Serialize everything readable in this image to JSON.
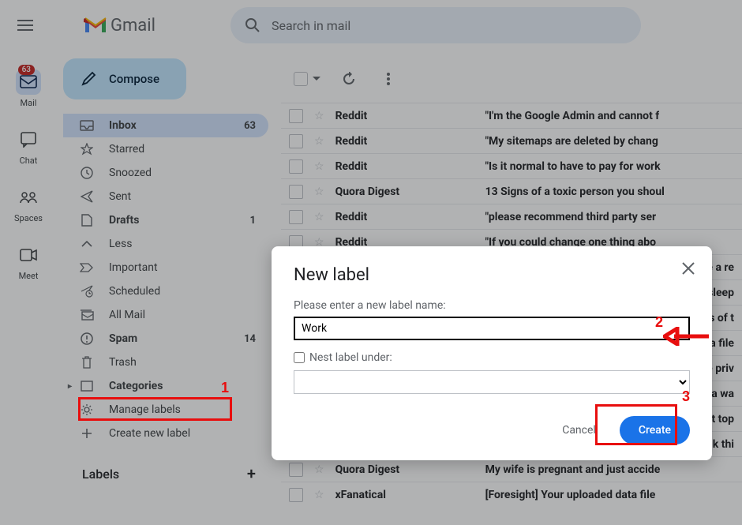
{
  "header": {
    "product_name": "Gmail",
    "search_placeholder": "Search in mail"
  },
  "rail": {
    "mail": {
      "label": "Mail",
      "badge": "63"
    },
    "chat": {
      "label": "Chat"
    },
    "spaces": {
      "label": "Spaces"
    },
    "meet": {
      "label": "Meet"
    }
  },
  "sidebar": {
    "compose_label": "Compose",
    "folders": [
      {
        "icon": "inbox-icon",
        "name": "Inbox",
        "count": "63",
        "selected": true,
        "bold": true
      },
      {
        "icon": "star-icon",
        "name": "Starred",
        "count": ""
      },
      {
        "icon": "clock-icon",
        "name": "Snoozed",
        "count": ""
      },
      {
        "icon": "send-icon",
        "name": "Sent",
        "count": ""
      },
      {
        "icon": "file-icon",
        "name": "Drafts",
        "count": "1",
        "bold": true
      },
      {
        "icon": "chevron-up-icon",
        "name": "Less",
        "count": ""
      },
      {
        "icon": "important-icon",
        "name": "Important",
        "count": ""
      },
      {
        "icon": "scheduled-icon",
        "name": "Scheduled",
        "count": ""
      },
      {
        "icon": "allmail-icon",
        "name": "All Mail",
        "count": ""
      },
      {
        "icon": "spam-icon",
        "name": "Spam",
        "count": "14",
        "bold": true
      },
      {
        "icon": "trash-icon",
        "name": "Trash",
        "count": ""
      },
      {
        "icon": "categories-icon",
        "name": "Categories",
        "count": "",
        "bold": true,
        "arrow": true
      },
      {
        "icon": "gear-icon",
        "name": "Manage labels",
        "count": ""
      },
      {
        "icon": "plus-icon",
        "name": "Create new label",
        "count": ""
      }
    ],
    "labels_header": "Labels"
  },
  "mail": {
    "rows": [
      {
        "sender": "Reddit",
        "subject": "\"I'm the Google Admin and cannot f"
      },
      {
        "sender": "Reddit",
        "subject": "\"My sitemaps are deleted by chang"
      },
      {
        "sender": "Reddit",
        "subject": "\"Is it normal to have to pay for work"
      },
      {
        "sender": "Quora Digest",
        "subject": "13 Signs of a toxic person you shoul"
      },
      {
        "sender": "Reddit",
        "subject": "\"please recommend third party ser"
      },
      {
        "sender": "Reddit",
        "subject": "\"If you could change one thing abo"
      },
      {
        "sender": "",
        "subject": "",
        "hidden_sender": true,
        "tail": "e a re"
      },
      {
        "sender": "",
        "subject": "",
        "hidden_sender": true,
        "tail": "sleep"
      },
      {
        "sender": "",
        "subject": "",
        "hidden_sender": true,
        "tail": "s of t"
      },
      {
        "sender": "",
        "subject": "",
        "hidden_sender": true,
        "tail": "a file"
      },
      {
        "sender": "",
        "subject": "",
        "hidden_sender": true,
        "tail": "e priv"
      },
      {
        "sender": "",
        "subject": "",
        "hidden_sender": true,
        "tail": "s a wa"
      },
      {
        "sender": "",
        "subject": "",
        "hidden_sender": true,
        "tail": "ut top"
      },
      {
        "sender": "",
        "subject": "",
        "hidden_sender": true,
        "tail": "k thi"
      },
      {
        "sender": "Quora Digest",
        "subject": "My wife is pregnant and just accide"
      },
      {
        "sender": "xFanatical",
        "subject": "[Foresight] Your uploaded data file "
      }
    ]
  },
  "modal": {
    "title": "New label",
    "name_label": "Please enter a new label name:",
    "name_value": "Work",
    "nest_label": "Nest label under:",
    "cancel_label": "Cancel",
    "create_label": "Create"
  },
  "annotations": {
    "n1": "1",
    "n2": "2",
    "n3": "3"
  }
}
